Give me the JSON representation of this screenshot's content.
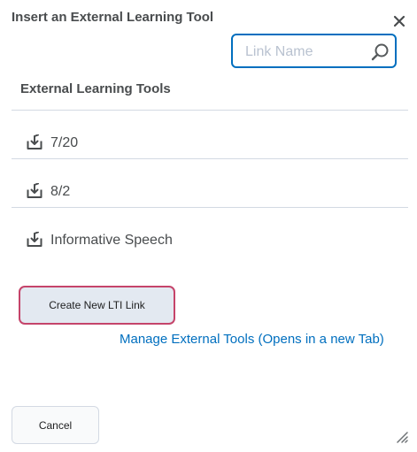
{
  "dialog": {
    "title": "Insert an External Learning Tool",
    "close_icon": "close-icon"
  },
  "search": {
    "placeholder": "Link Name",
    "value": "",
    "icon": "search-icon"
  },
  "tools": {
    "heading": "External Learning Tools",
    "items": [
      {
        "label": "7/20",
        "icon": "insert-download-icon"
      },
      {
        "label": "8/2",
        "icon": "insert-download-icon"
      },
      {
        "label": "Informative Speech",
        "icon": "insert-download-icon"
      }
    ]
  },
  "actions": {
    "create_label": "Create New LTI Link",
    "manage_link_label": "Manage External Tools (Opens in a new Tab)",
    "cancel_label": "Cancel"
  },
  "colors": {
    "accent": "#006fbf",
    "focus_ring": "#c5446a",
    "text": "#494c4e",
    "divider": "#d3d9e3"
  }
}
